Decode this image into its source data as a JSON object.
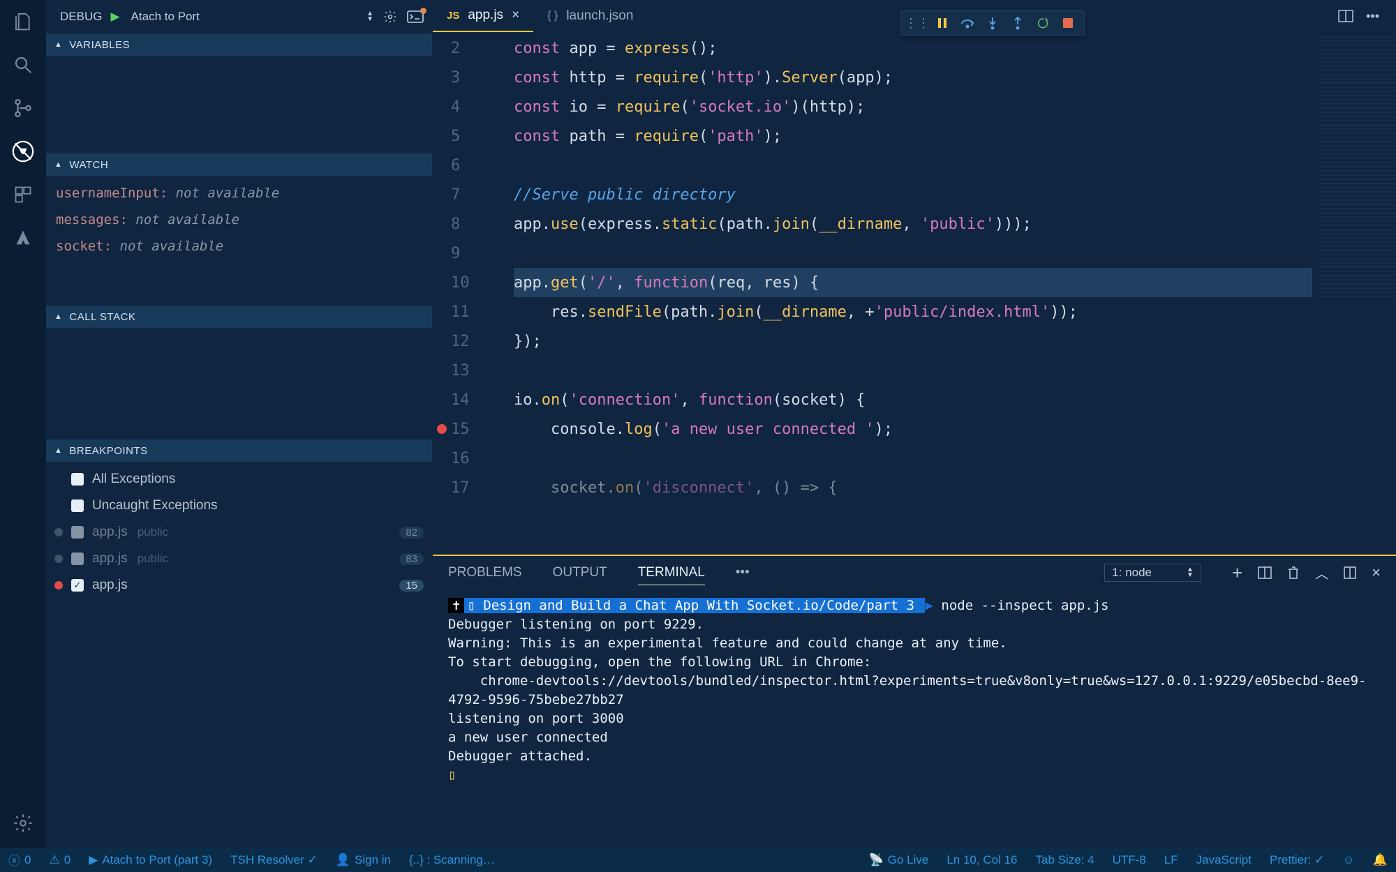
{
  "activity": {
    "items": [
      "files",
      "search",
      "scm",
      "debug",
      "extensions",
      "azure"
    ]
  },
  "debugHeader": {
    "label": "DEBUG",
    "config": "Atach to Port"
  },
  "panels": {
    "variables": "VARIABLES",
    "watch": "WATCH",
    "callstack": "CALL STACK",
    "breakpoints": "BREAKPOINTS"
  },
  "watch": [
    {
      "name": "usernameInput:",
      "value": "not available"
    },
    {
      "name": "messages:",
      "value": "not available"
    },
    {
      "name": "socket:",
      "value": "not available"
    }
  ],
  "breakpoints": {
    "allEx": "All Exceptions",
    "uncEx": "Uncaught Exceptions",
    "list": [
      {
        "file": "app.js",
        "ctx": "public",
        "badge": "82",
        "dim": true,
        "dot": "grey",
        "chk": false
      },
      {
        "file": "app.js",
        "ctx": "public",
        "badge": "83",
        "dim": true,
        "dot": "grey",
        "chk": false
      },
      {
        "file": "app.js",
        "ctx": "",
        "badge": "15",
        "dim": false,
        "dot": "red",
        "chk": true
      }
    ]
  },
  "tabs": [
    {
      "kind": "js",
      "label": "app.js",
      "active": true,
      "close": true
    },
    {
      "kind": "json",
      "label": "launch.json",
      "active": false,
      "close": false
    }
  ],
  "code": {
    "start": 2,
    "lines": [
      {
        "n": 2,
        "t": [
          [
            "kw",
            "const "
          ],
          [
            "var",
            "app"
          ],
          [
            "op",
            " = "
          ],
          [
            "fn",
            "express"
          ],
          [
            "op",
            "();"
          ]
        ]
      },
      {
        "n": 3,
        "t": [
          [
            "kw",
            "const "
          ],
          [
            "var",
            "http"
          ],
          [
            "op",
            " = "
          ],
          [
            "fn",
            "require"
          ],
          [
            "op",
            "("
          ],
          [
            "str",
            "'http'"
          ],
          [
            "op",
            ")."
          ],
          [
            "fn",
            "Server"
          ],
          [
            "op",
            "(app);"
          ]
        ]
      },
      {
        "n": 4,
        "t": [
          [
            "kw",
            "const "
          ],
          [
            "var",
            "io"
          ],
          [
            "op",
            " = "
          ],
          [
            "fn",
            "require"
          ],
          [
            "op",
            "("
          ],
          [
            "str",
            "'socket.io'"
          ],
          [
            "op",
            ")(http);"
          ]
        ]
      },
      {
        "n": 5,
        "t": [
          [
            "kw",
            "const "
          ],
          [
            "var",
            "path"
          ],
          [
            "op",
            " = "
          ],
          [
            "fn",
            "require"
          ],
          [
            "op",
            "("
          ],
          [
            "str",
            "'path'"
          ],
          [
            "op",
            ");"
          ]
        ]
      },
      {
        "n": 6,
        "t": []
      },
      {
        "n": 7,
        "t": [
          [
            "cm",
            "//Serve public directory"
          ]
        ]
      },
      {
        "n": 8,
        "t": [
          [
            "var",
            "app"
          ],
          [
            "op",
            "."
          ],
          [
            "fn",
            "use"
          ],
          [
            "op",
            "(express."
          ],
          [
            "fn",
            "static"
          ],
          [
            "op",
            "(path."
          ],
          [
            "fn",
            "join"
          ],
          [
            "op",
            "("
          ],
          [
            "pp",
            "__dirname"
          ],
          [
            "op",
            ", "
          ],
          [
            "str",
            "'public'"
          ],
          [
            "op",
            ")));"
          ]
        ]
      },
      {
        "n": 9,
        "t": []
      },
      {
        "n": 10,
        "hl": true,
        "t": [
          [
            "var",
            "app"
          ],
          [
            "op",
            "."
          ],
          [
            "fn",
            "get"
          ],
          [
            "op",
            "("
          ],
          [
            "str",
            "'/'"
          ],
          [
            "op",
            ", "
          ],
          [
            "kw",
            "function"
          ],
          [
            "op",
            "("
          ],
          [
            "var",
            "req"
          ],
          [
            "op",
            ", "
          ],
          [
            "var",
            "res"
          ],
          [
            "op",
            ") {"
          ]
        ]
      },
      {
        "n": 11,
        "t": [
          [
            "op",
            "    res."
          ],
          [
            "fn",
            "sendFile"
          ],
          [
            "op",
            "(path."
          ],
          [
            "fn",
            "join"
          ],
          [
            "op",
            "("
          ],
          [
            "pp",
            "__dirname"
          ],
          [
            "op",
            ", +"
          ],
          [
            "str",
            "'public/index.html'"
          ],
          [
            "op",
            "));"
          ]
        ]
      },
      {
        "n": 12,
        "t": [
          [
            "op",
            "});"
          ]
        ]
      },
      {
        "n": 13,
        "t": []
      },
      {
        "n": 14,
        "t": [
          [
            "var",
            "io"
          ],
          [
            "op",
            "."
          ],
          [
            "fn",
            "on"
          ],
          [
            "op",
            "("
          ],
          [
            "str",
            "'connection'"
          ],
          [
            "op",
            ", "
          ],
          [
            "kw",
            "function"
          ],
          [
            "op",
            "("
          ],
          [
            "var",
            "socket"
          ],
          [
            "op",
            ") {"
          ]
        ]
      },
      {
        "n": 15,
        "bp": true,
        "t": [
          [
            "op",
            "    console."
          ],
          [
            "fn",
            "log"
          ],
          [
            "op",
            "("
          ],
          [
            "str",
            "'a new user connected '"
          ],
          [
            "op",
            ");"
          ]
        ]
      },
      {
        "n": 16,
        "t": []
      },
      {
        "n": 17,
        "dim": true,
        "t": [
          [
            "op",
            "    socket."
          ],
          [
            "fn",
            "on"
          ],
          [
            "op",
            "("
          ],
          [
            "str",
            "'disconnect'"
          ],
          [
            "op",
            ", () => {"
          ]
        ]
      }
    ]
  },
  "bottom": {
    "tabs": {
      "problems": "PROBLEMS",
      "output": "OUTPUT",
      "terminal": "TERMINAL"
    },
    "select": "1: node",
    "term": {
      "promptPath": " Design and Build a Chat App With Socket.io/Code/part 3 ",
      "cmd": "node --inspect app.js",
      "lines": [
        "Debugger listening on port 9229.",
        "Warning: This is an experimental feature and could change at any time.",
        "To start debugging, open the following URL in Chrome:",
        "    chrome-devtools://devtools/bundled/inspector.html?experiments=true&v8only=true&ws=127.0.0.1:9229/e05becbd-8ee9-4792-9596-75bebe27bb27",
        "listening on port 3000",
        "a new user connected",
        "Debugger attached."
      ]
    }
  },
  "status": {
    "errs": "0",
    "warns": "0",
    "launch": "Atach to Port (part 3)",
    "resolver": "TSH Resolver ✓",
    "signin": "Sign in",
    "scan": "{..} : Scanning…",
    "golive": "Go Live",
    "pos": "Ln 10, Col 16",
    "tab": "Tab Size: 4",
    "enc": "UTF-8",
    "eol": "LF",
    "lang": "JavaScript",
    "prettier": "Prettier: ✓"
  }
}
